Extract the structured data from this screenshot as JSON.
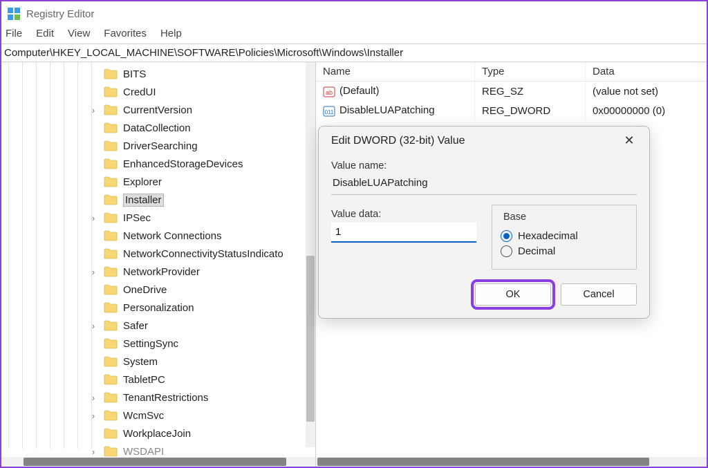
{
  "app_title": "Registry Editor",
  "menubar": [
    "File",
    "Edit",
    "View",
    "Favorites",
    "Help"
  ],
  "address": "Computer\\HKEY_LOCAL_MACHINE\\SOFTWARE\\Policies\\Microsoft\\Windows\\Installer",
  "tree_items": [
    {
      "label": "BITS",
      "expand": false
    },
    {
      "label": "CredUI",
      "expand": false
    },
    {
      "label": "CurrentVersion",
      "expand": true
    },
    {
      "label": "DataCollection",
      "expand": false
    },
    {
      "label": "DriverSearching",
      "expand": false
    },
    {
      "label": "EnhancedStorageDevices",
      "expand": false
    },
    {
      "label": "Explorer",
      "expand": false
    },
    {
      "label": "Installer",
      "expand": false,
      "selected": true
    },
    {
      "label": "IPSec",
      "expand": true
    },
    {
      "label": "Network Connections",
      "expand": false
    },
    {
      "label": "NetworkConnectivityStatusIndicato",
      "expand": false
    },
    {
      "label": "NetworkProvider",
      "expand": true
    },
    {
      "label": "OneDrive",
      "expand": false
    },
    {
      "label": "Personalization",
      "expand": false
    },
    {
      "label": "Safer",
      "expand": true
    },
    {
      "label": "SettingSync",
      "expand": false
    },
    {
      "label": "System",
      "expand": false
    },
    {
      "label": "TabletPC",
      "expand": false
    },
    {
      "label": "TenantRestrictions",
      "expand": true
    },
    {
      "label": "WcmSvc",
      "expand": true
    },
    {
      "label": "WorkplaceJoin",
      "expand": false
    },
    {
      "label": "WSDAPI",
      "expand": true,
      "partial": true
    }
  ],
  "value_columns": [
    "Name",
    "Type",
    "Data"
  ],
  "value_rows": [
    {
      "icon": "string",
      "name": "(Default)",
      "type": "REG_SZ",
      "data": "(value not set)"
    },
    {
      "icon": "binary",
      "name": "DisableLUAPatching",
      "type": "REG_DWORD",
      "data": "0x00000000 (0)"
    }
  ],
  "dialog": {
    "title": "Edit DWORD (32-bit) Value",
    "value_name_label": "Value name:",
    "value_name": "DisableLUAPatching",
    "value_data_label": "Value data:",
    "value_data": "1",
    "base_label": "Base",
    "radio_hex": "Hexadecimal",
    "radio_dec": "Decimal",
    "ok": "OK",
    "cancel": "Cancel"
  }
}
